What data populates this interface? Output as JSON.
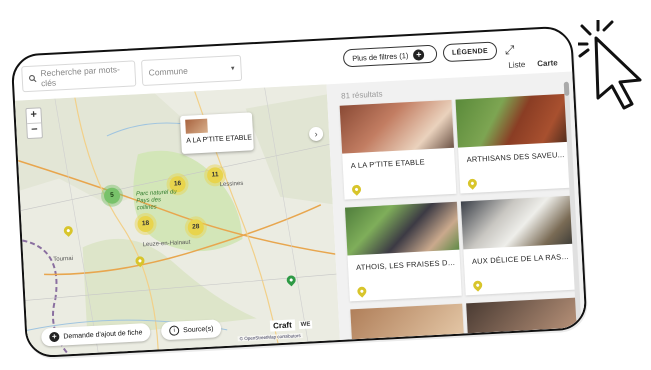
{
  "filters": {
    "search_placeholder": "Recherche par mots-clés",
    "commune_label": "Commune",
    "more_filters_label": "Plus de filtres (1)",
    "legend_label": "LÉGENDE"
  },
  "view": {
    "results_count": "81 résultats",
    "list_label": "Liste",
    "map_label": "Carte",
    "active": "Carte"
  },
  "map": {
    "popup_title": "A LA P'TITE ETABLE",
    "clusters": [
      {
        "label": "5",
        "color": "green"
      },
      {
        "label": "16",
        "color": "yellow"
      },
      {
        "label": "11",
        "color": "yellow"
      },
      {
        "label": "18",
        "color": "yellow"
      },
      {
        "label": "28",
        "color": "yellow"
      }
    ],
    "place_labels": [
      "Tournai",
      "Leuze-en-Hainaut",
      "Parc naturel du Pays des collines",
      "Lessines"
    ],
    "add_request_label": "Demande d'ajout de fiche",
    "sources_label": "Source(s)",
    "partner_logos": [
      "Craft",
      "WE"
    ],
    "attribution": "© OpenStreetMap contributors"
  },
  "cards": [
    {
      "title": "A LA P'TITE ETABLE",
      "image": "shop-counter-photo"
    },
    {
      "title": "ARTHISANS DES SAVEU...",
      "image": "pig-photo"
    },
    {
      "title": "ATHOIS, LES FRAISES DE...",
      "image": "farmers-greenhouse-photo"
    },
    {
      "title": "AUX DÉLICE DE LA RASP...",
      "image": "shop-interior-photo"
    }
  ],
  "colors": {
    "accent_yellow": "#e8d44d",
    "accent_green": "#78c26a",
    "pin_yellow": "#d8c52b",
    "pin_green": "#2e9a45",
    "panel_bg": "#f1f1f1"
  }
}
